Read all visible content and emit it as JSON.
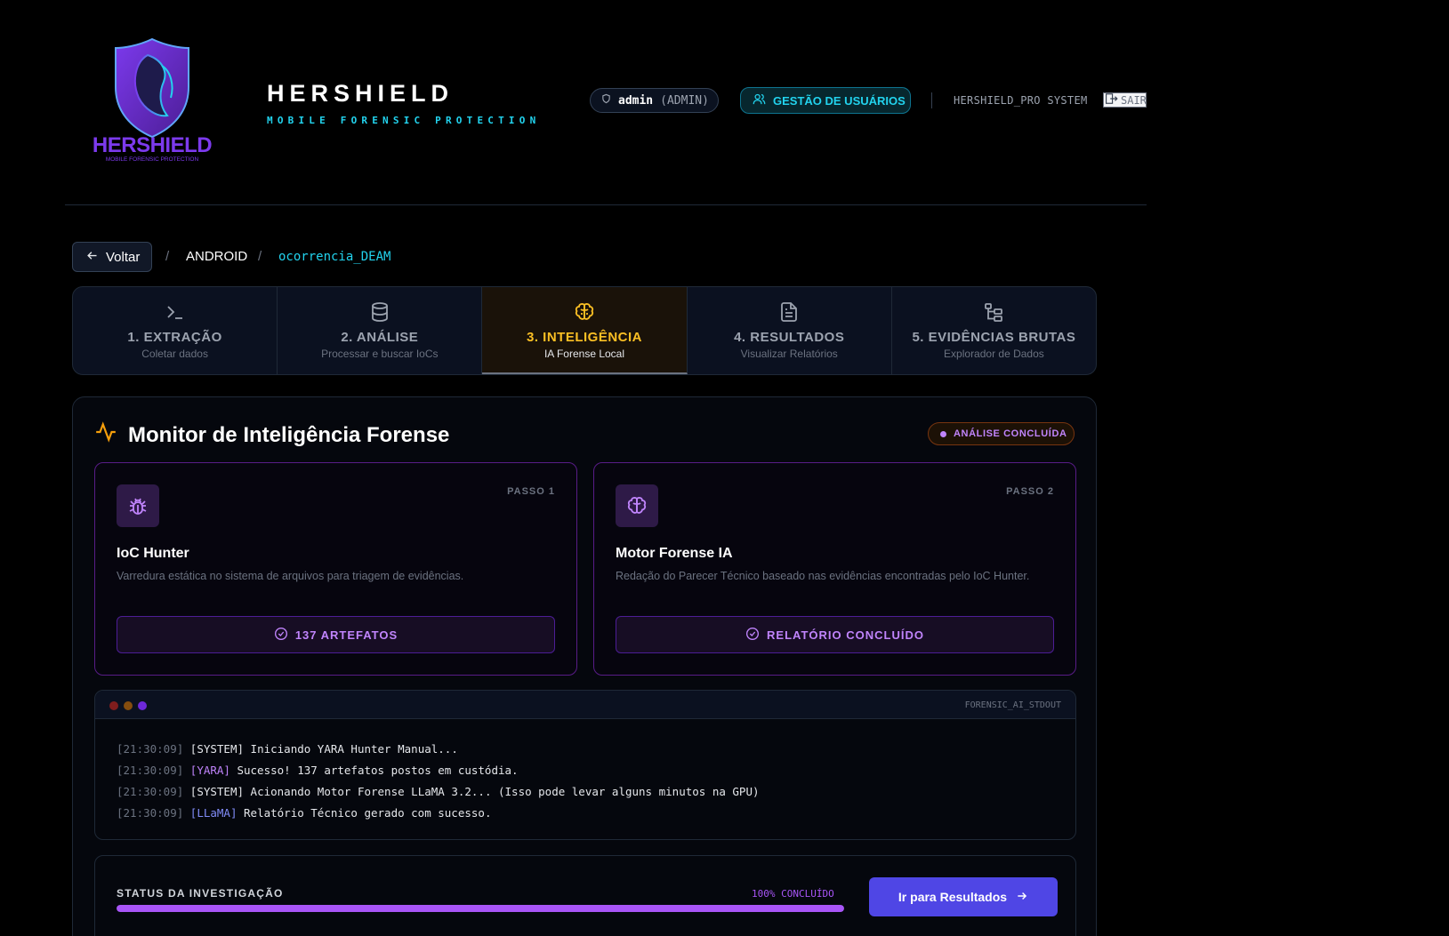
{
  "header": {
    "logo_text": "HERSHIELD",
    "logo_subtext": "MOBILE FORENSIC PROTECTION",
    "brand_title": "HERSHIELD",
    "brand_subtitle": "MOBILE FORENSIC PROTECTION",
    "user_name": "admin",
    "user_role": "(ADMIN)",
    "users_button": "GESTÃO DE USUÁRIOS",
    "system_name": "HERSHIELD_PRO SYSTEM",
    "logout_label": "SAIR"
  },
  "breadcrumb": {
    "back_label": "Voltar",
    "sep": "/",
    "platform": "ANDROID",
    "case": "ocorrencia_DEAM"
  },
  "steps": [
    {
      "title": "1. EXTRAÇÃO",
      "subtitle": "Coletar dados",
      "icon": "terminal-icon"
    },
    {
      "title": "2. ANÁLISE",
      "subtitle": "Processar e buscar IoCs",
      "icon": "database-icon"
    },
    {
      "title": "3. INTELIGÊNCIA",
      "subtitle": "IA Forense Local",
      "icon": "brain-icon",
      "active": true
    },
    {
      "title": "4. RESULTADOS",
      "subtitle": "Visualizar Relatórios",
      "icon": "file-text-icon"
    },
    {
      "title": "5. EVIDÊNCIAS BRUTAS",
      "subtitle": "Explorador de Dados",
      "icon": "folder-tree-icon"
    }
  ],
  "monitor": {
    "title": "Monitor de Inteligência Forense",
    "status_badge": "ANÁLISE CONCLUÍDA",
    "cards": [
      {
        "step": "PASSO 1",
        "title": "IoC Hunter",
        "description": "Varredura estática no sistema de arquivos para triagem de evidências.",
        "result": "137 ARTEFATOS",
        "icon": "bug-icon"
      },
      {
        "step": "PASSO 2",
        "title": "Motor Forense IA",
        "description": "Redação do Parecer Técnico baseado nas evidências encontradas pelo IoC Hunter.",
        "result": "RELATÓRIO CONCLUÍDO",
        "icon": "brain-icon"
      }
    ],
    "terminal": {
      "name": "FORENSIC_AI_STDOUT",
      "lines": [
        {
          "time": "[21:30:09]",
          "tag": "[SYSTEM]",
          "text": "Iniciando YARA Hunter Manual..."
        },
        {
          "time": "[21:30:09]",
          "tag": "[YARA]",
          "text": "Sucesso! 137 artefatos postos em custódia."
        },
        {
          "time": "[21:30:09]",
          "tag": "[SYSTEM]",
          "text": "Acionando Motor Forense LLaMA 3.2... (Isso pode levar alguns minutos na GPU)"
        },
        {
          "time": "[21:30:09]",
          "tag": "[LLaMA]",
          "text": "Relatório Técnico gerado com sucesso."
        }
      ]
    },
    "status": {
      "label": "STATUS DA INVESTIGAÇÃO",
      "percent_text": "100% CONCLUÍDO",
      "progress": 1.0,
      "button": "Ir para Resultados"
    }
  },
  "colors": {
    "accent_cyan": "#22d3ee",
    "accent_purple": "#a855f7",
    "accent_amber": "#fbbf24",
    "button_indigo": "#4f46e5"
  }
}
